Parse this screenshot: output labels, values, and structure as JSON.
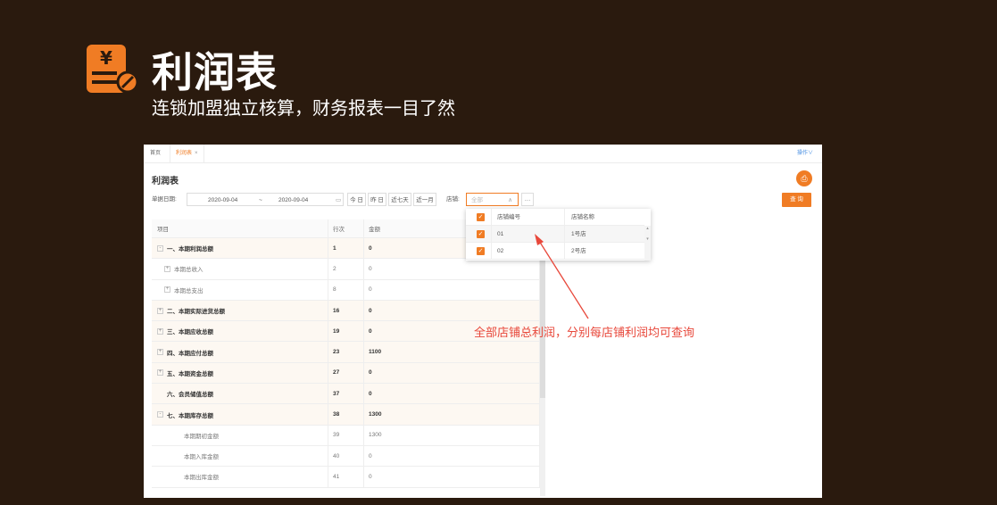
{
  "banner": {
    "title": "利润表",
    "subtitle": "连锁加盟独立核算，财务报表一目了然",
    "icon": "yen-report-icon"
  },
  "tabs": [
    {
      "label": "首页"
    },
    {
      "label": "利润表",
      "close": "×",
      "active": true
    }
  ],
  "header_ops": "操作∨",
  "page_title": "利润表",
  "filter": {
    "date_label": "单据日期:",
    "date_start": "2020-09-04",
    "date_sep": "~",
    "date_end": "2020-09-04",
    "quick": [
      "今 日",
      "昨 日",
      "近七天",
      "近一月"
    ],
    "store_label": "店铺:",
    "store_placeholder": "全部",
    "more": "···",
    "query": "查 询"
  },
  "table": {
    "headers": [
      "项目",
      "行次",
      "金额"
    ],
    "rows": [
      {
        "expander": "-",
        "item": "一、本期利润总额",
        "line": "1",
        "amount": "0",
        "level": 0
      },
      {
        "expander": "+",
        "item": "本期总收入",
        "line": "2",
        "amount": "0",
        "level": 1
      },
      {
        "expander": "+",
        "item": "本期总支出",
        "line": "8",
        "amount": "0",
        "level": 1
      },
      {
        "expander": "+",
        "item": "二、本期实际进货总额",
        "line": "16",
        "amount": "0",
        "level": 0
      },
      {
        "expander": "+",
        "item": "三、本期应收总额",
        "line": "19",
        "amount": "0",
        "level": 0
      },
      {
        "expander": "+",
        "item": "四、本期应付总额",
        "line": "23",
        "amount": "1100",
        "level": 0
      },
      {
        "expander": "+",
        "item": "五、本期资金总额",
        "line": "27",
        "amount": "0",
        "level": 0
      },
      {
        "expander": "",
        "item": "六、会员储值总额",
        "line": "37",
        "amount": "0",
        "level": 0
      },
      {
        "expander": "-",
        "item": "七、本期库存总额",
        "line": "38",
        "amount": "1300",
        "level": 0
      },
      {
        "expander": "",
        "item": "本期期初金额",
        "line": "39",
        "amount": "1300",
        "level": 2
      },
      {
        "expander": "",
        "item": "本期入库金额",
        "line": "40",
        "amount": "0",
        "level": 2
      },
      {
        "expander": "",
        "item": "本期出库金额",
        "line": "41",
        "amount": "0",
        "level": 2
      }
    ]
  },
  "store_dropdown": {
    "headers": [
      "店铺编号",
      "店铺名称"
    ],
    "rows": [
      {
        "code": "01",
        "name": "1号店"
      },
      {
        "code": "02",
        "name": "2号店"
      }
    ]
  },
  "annotation": "全部店铺总利润，分别每店铺利润均可查询",
  "colors": {
    "accent": "#f07c24",
    "background": "#2a1a0e",
    "annotation": "#e8483b"
  }
}
